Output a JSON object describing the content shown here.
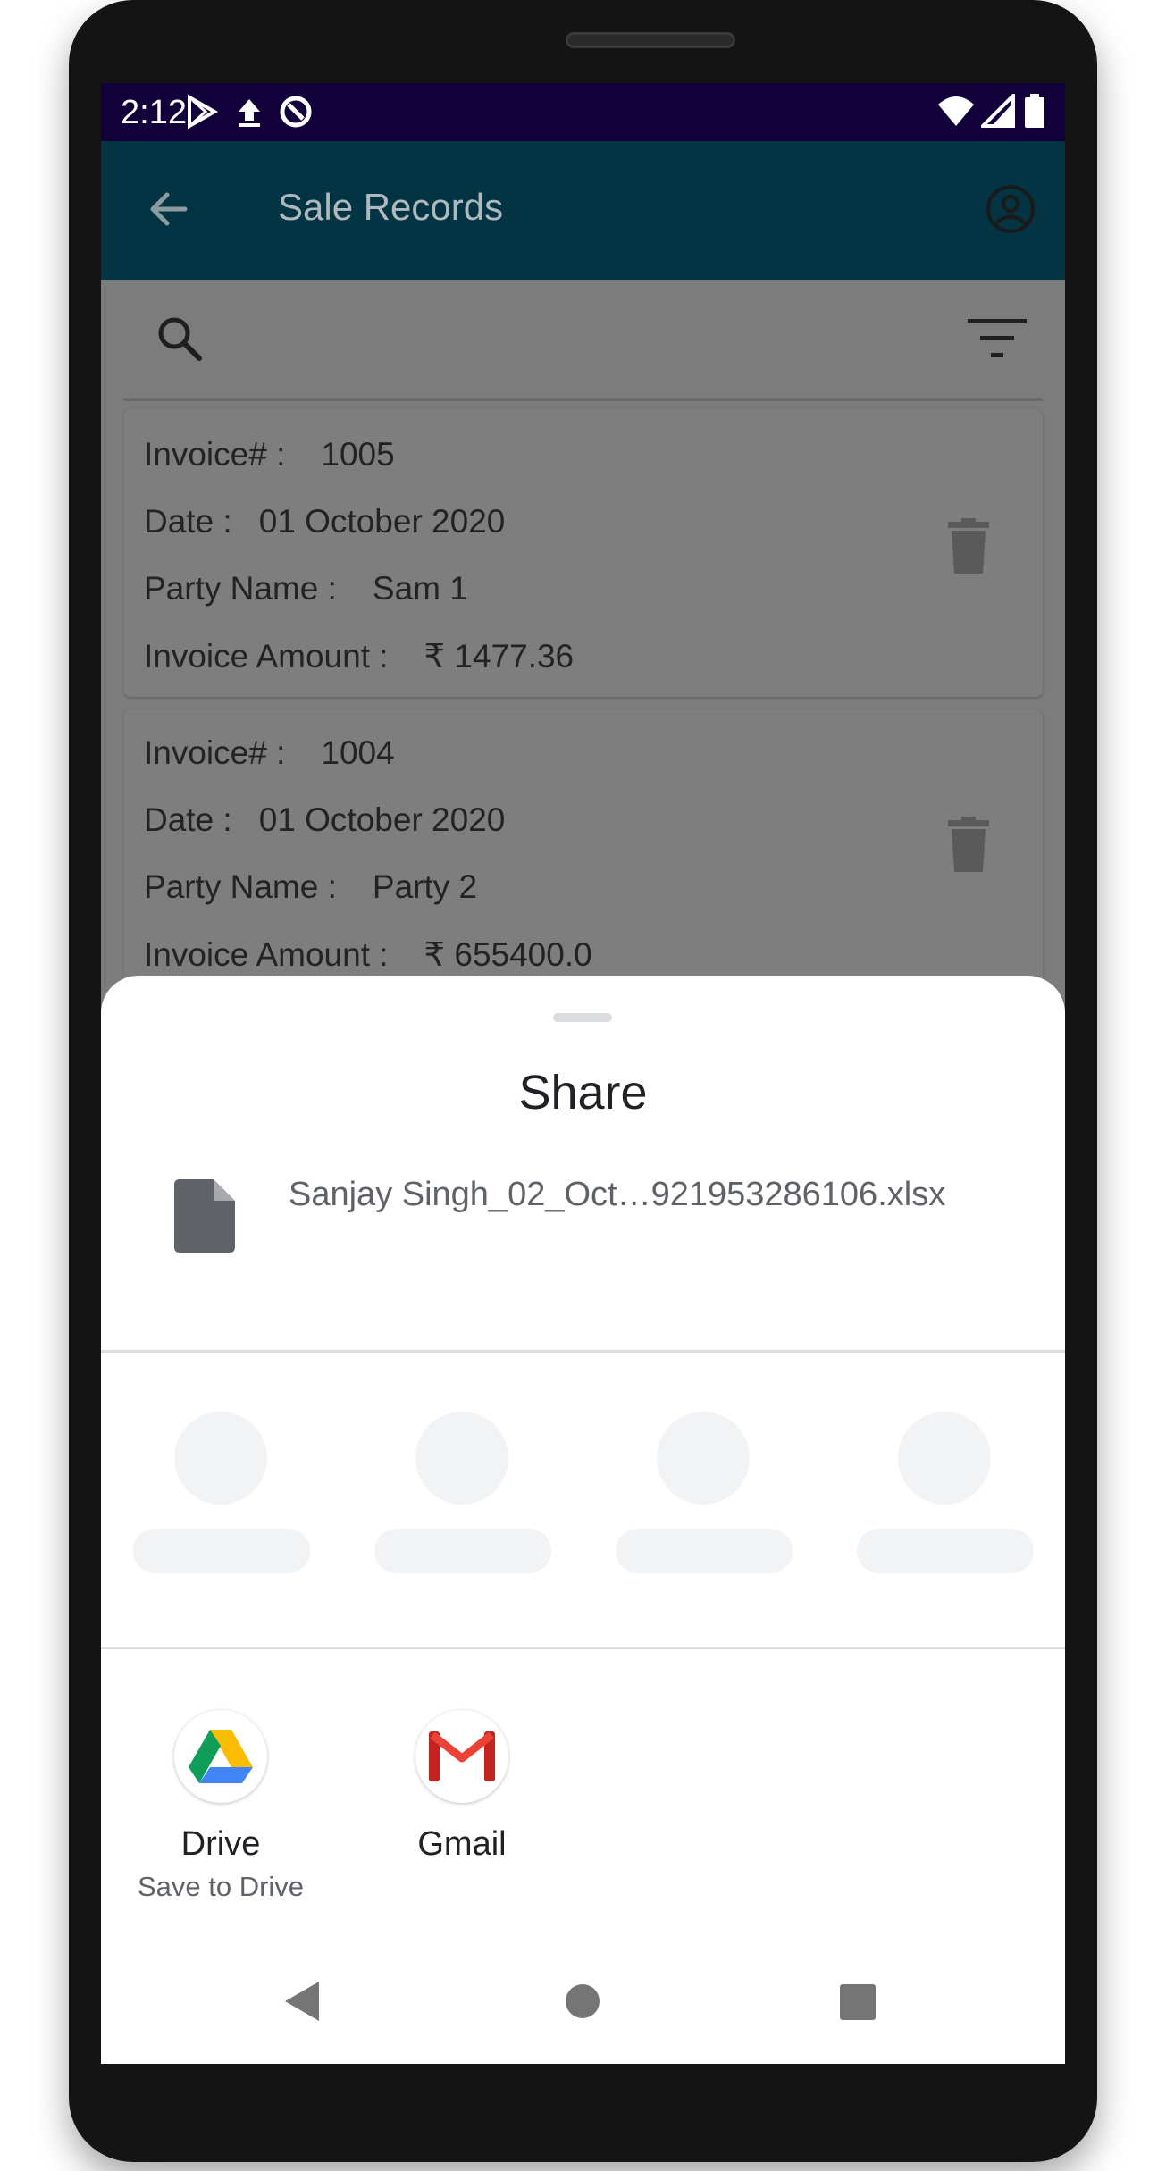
{
  "status_bar": {
    "time": "2:12",
    "icons_left": [
      "play-store-icon",
      "upload-icon",
      "sync-icon"
    ],
    "icons_right": [
      "wifi-icon",
      "signal-icon",
      "battery-icon"
    ]
  },
  "app_bar": {
    "title": "Sale Records",
    "back_icon": "arrow-left-icon",
    "profile_icon": "account-circle-icon"
  },
  "search": {
    "search_icon": "search-icon",
    "filter_icon": "filter-icon"
  },
  "records": [
    {
      "invoice_label": "Invoice# :",
      "invoice": "1005",
      "date_label": "Date :",
      "date": "01 October 2020",
      "party_label": "Party Name :",
      "party": "Sam 1",
      "amount_label": "Invoice Amount :",
      "amount": "₹ 1477.36"
    },
    {
      "invoice_label": "Invoice# :",
      "invoice": "1004",
      "date_label": "Date :",
      "date": "01 October 2020",
      "party_label": "Party Name :",
      "party": "Party 2",
      "amount_label": "Invoice Amount :",
      "amount": "₹ 655400.0"
    }
  ],
  "share_sheet": {
    "title": "Share",
    "file_name": "Sanjay Singh_02_Oct…921953286106.xlsx",
    "file_icon": "file-icon",
    "apps": [
      {
        "name": "Drive",
        "subtitle": "Save to Drive",
        "icon": "google-drive-icon"
      },
      {
        "name": "Gmail",
        "subtitle": "",
        "icon": "gmail-icon"
      }
    ]
  },
  "nav_bar": {
    "back": "nav-back-icon",
    "home": "nav-home-icon",
    "recents": "nav-recents-icon"
  },
  "colors": {
    "status_bar": "#12003a",
    "app_bar": "#033444",
    "scrim_content": "#7c7c7c",
    "sheet": "#ffffff"
  }
}
